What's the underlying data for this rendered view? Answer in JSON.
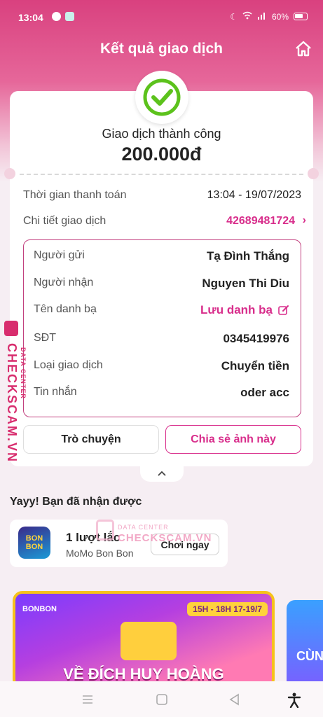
{
  "status_bar": {
    "time": "13:04",
    "battery": "60%"
  },
  "header": {
    "title": "Kết quả giao dịch"
  },
  "receipt": {
    "status": "Giao dịch thành công",
    "amount": "200.000đ",
    "payment_time_label": "Thời gian thanh toán",
    "payment_time_value": "13:04 - 19/07/2023",
    "detail_label": "Chi tiết giao dịch",
    "detail_value": "42689481724",
    "rows": [
      {
        "label": "Người gửi",
        "value": "Tạ Đình Thắng"
      },
      {
        "label": "Người nhận",
        "value": "Nguyen Thi Diu"
      },
      {
        "label": "Tên danh bạ",
        "value": "Lưu danh bạ"
      },
      {
        "label": "SĐT",
        "value": "0345419976"
      },
      {
        "label": "Loại giao dịch",
        "value": "Chuyển tiền"
      },
      {
        "label": "Tin nhắn",
        "value": "oder acc"
      }
    ],
    "chat_button": "Trò chuyện",
    "share_button": "Chia sẻ ảnh này"
  },
  "rewards": {
    "title": "Yayy! Bạn đã nhận được",
    "item_title": "1 lượt lắc",
    "item_sub": "MoMo Bon Bon",
    "play_button": "Chơi ngay",
    "game_icon_label": "BON BON"
  },
  "banner": {
    "time_badge": "15H - 18H  17-19/7",
    "logo": "BONBON",
    "headline": "VỀ ĐÍCH HUY HOÀNG",
    "side_text": "CÙN"
  },
  "watermark": {
    "text": "CHECKSCAM.VN",
    "sub": "DATA CENTER"
  },
  "colors": {
    "brand_pink": "#d82d8b",
    "header_pink": "#d9417f",
    "success_green": "#5cc21c"
  }
}
